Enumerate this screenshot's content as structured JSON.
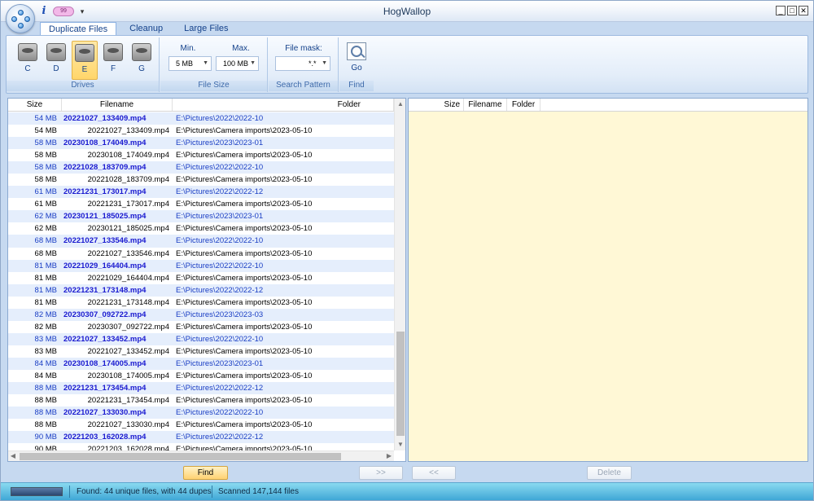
{
  "window": {
    "title": "HogWallop"
  },
  "qat": {
    "pill_text": "99"
  },
  "tabs": [
    {
      "label": "Duplicate Files",
      "active": true
    },
    {
      "label": "Cleanup",
      "active": false
    },
    {
      "label": "Large Files",
      "active": false
    }
  ],
  "ribbon": {
    "drives": {
      "label": "Drives",
      "items": [
        {
          "letter": "C",
          "selected": false
        },
        {
          "letter": "D",
          "selected": false
        },
        {
          "letter": "E",
          "selected": true
        },
        {
          "letter": "F",
          "selected": false
        },
        {
          "letter": "G",
          "selected": false
        }
      ]
    },
    "file_size": {
      "label": "File Size",
      "min_label": "Min.",
      "min_value": "5 MB",
      "max_label": "Max.",
      "max_value": "100 MB"
    },
    "search_pattern": {
      "label": "Search Pattern",
      "mask_label": "File mask:",
      "mask_value": "*.*"
    },
    "find_group": {
      "label": "Find",
      "go_label": "Go"
    }
  },
  "left_table": {
    "columns": [
      "Size",
      "Filename",
      "Folder"
    ],
    "rows": [
      {
        "size": "54 MB",
        "filename": "20221027_133409.mp4",
        "folder": "E:\\Pictures\\2022\\2022-10",
        "dup": true
      },
      {
        "size": "54 MB",
        "filename": "20221027_133409.mp4",
        "folder": "E:\\Pictures\\Camera imports\\2023-05-10",
        "dup": false
      },
      {
        "size": "58 MB",
        "filename": "20230108_174049.mp4",
        "folder": "E:\\Pictures\\2023\\2023-01",
        "dup": true
      },
      {
        "size": "58 MB",
        "filename": "20230108_174049.mp4",
        "folder": "E:\\Pictures\\Camera imports\\2023-05-10",
        "dup": false
      },
      {
        "size": "58 MB",
        "filename": "20221028_183709.mp4",
        "folder": "E:\\Pictures\\2022\\2022-10",
        "dup": true
      },
      {
        "size": "58 MB",
        "filename": "20221028_183709.mp4",
        "folder": "E:\\Pictures\\Camera imports\\2023-05-10",
        "dup": false
      },
      {
        "size": "61 MB",
        "filename": "20221231_173017.mp4",
        "folder": "E:\\Pictures\\2022\\2022-12",
        "dup": true
      },
      {
        "size": "61 MB",
        "filename": "20221231_173017.mp4",
        "folder": "E:\\Pictures\\Camera imports\\2023-05-10",
        "dup": false
      },
      {
        "size": "62 MB",
        "filename": "20230121_185025.mp4",
        "folder": "E:\\Pictures\\2023\\2023-01",
        "dup": true
      },
      {
        "size": "62 MB",
        "filename": "20230121_185025.mp4",
        "folder": "E:\\Pictures\\Camera imports\\2023-05-10",
        "dup": false
      },
      {
        "size": "68 MB",
        "filename": "20221027_133546.mp4",
        "folder": "E:\\Pictures\\2022\\2022-10",
        "dup": true
      },
      {
        "size": "68 MB",
        "filename": "20221027_133546.mp4",
        "folder": "E:\\Pictures\\Camera imports\\2023-05-10",
        "dup": false
      },
      {
        "size": "81 MB",
        "filename": "20221029_164404.mp4",
        "folder": "E:\\Pictures\\2022\\2022-10",
        "dup": true
      },
      {
        "size": "81 MB",
        "filename": "20221029_164404.mp4",
        "folder": "E:\\Pictures\\Camera imports\\2023-05-10",
        "dup": false
      },
      {
        "size": "81 MB",
        "filename": "20221231_173148.mp4",
        "folder": "E:\\Pictures\\2022\\2022-12",
        "dup": true
      },
      {
        "size": "81 MB",
        "filename": "20221231_173148.mp4",
        "folder": "E:\\Pictures\\Camera imports\\2023-05-10",
        "dup": false
      },
      {
        "size": "82 MB",
        "filename": "20230307_092722.mp4",
        "folder": "E:\\Pictures\\2023\\2023-03",
        "dup": true
      },
      {
        "size": "82 MB",
        "filename": "20230307_092722.mp4",
        "folder": "E:\\Pictures\\Camera imports\\2023-05-10",
        "dup": false
      },
      {
        "size": "83 MB",
        "filename": "20221027_133452.mp4",
        "folder": "E:\\Pictures\\2022\\2022-10",
        "dup": true
      },
      {
        "size": "83 MB",
        "filename": "20221027_133452.mp4",
        "folder": "E:\\Pictures\\Camera imports\\2023-05-10",
        "dup": false
      },
      {
        "size": "84 MB",
        "filename": "20230108_174005.mp4",
        "folder": "E:\\Pictures\\2023\\2023-01",
        "dup": true
      },
      {
        "size": "84 MB",
        "filename": "20230108_174005.mp4",
        "folder": "E:\\Pictures\\Camera imports\\2023-05-10",
        "dup": false
      },
      {
        "size": "88 MB",
        "filename": "20221231_173454.mp4",
        "folder": "E:\\Pictures\\2022\\2022-12",
        "dup": true
      },
      {
        "size": "88 MB",
        "filename": "20221231_173454.mp4",
        "folder": "E:\\Pictures\\Camera imports\\2023-05-10",
        "dup": false
      },
      {
        "size": "88 MB",
        "filename": "20221027_133030.mp4",
        "folder": "E:\\Pictures\\2022\\2022-10",
        "dup": true
      },
      {
        "size": "88 MB",
        "filename": "20221027_133030.mp4",
        "folder": "E:\\Pictures\\Camera imports\\2023-05-10",
        "dup": false
      },
      {
        "size": "90 MB",
        "filename": "20221203_162028.mp4",
        "folder": "E:\\Pictures\\2022\\2022-12",
        "dup": true
      },
      {
        "size": "90 MB",
        "filename": "20221203_162028.mp4",
        "folder": "E:\\Pictures\\Camera imports\\2023-05-10",
        "dup": false
      }
    ]
  },
  "right_table": {
    "columns": [
      "Size",
      "Filename",
      "Folder"
    ]
  },
  "buttons": {
    "find": "Find",
    "move_right": ">>",
    "move_left": "<<",
    "delete": "Delete"
  },
  "status": {
    "progress": 1.0,
    "found": "Found: 44 unique files, with 44 dupes",
    "scanned": "Scanned 147,144 files"
  }
}
